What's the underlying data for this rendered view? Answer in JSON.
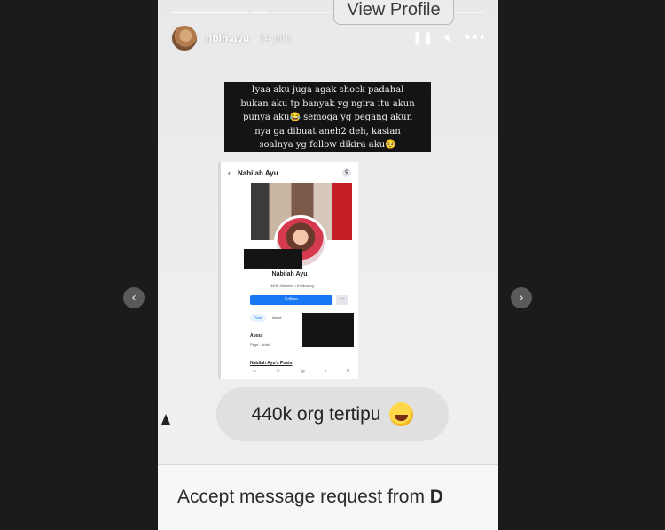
{
  "story": {
    "view_profile": "View Profile",
    "header": {
      "username": "nblh.ayu",
      "time_ago": "14 jam",
      "pause_icon": "pause-icon",
      "mute_icon": "mute-icon",
      "more_icon": "more-icon"
    },
    "caption": "Iyaa aku juga agak shock padahal\nbukan aku tp banyak yg ngira itu akun\npunya aku😂 semoga yg pegang akun\nnya ga dibuat aneh2 deh, kasian\nsoalnya yg follow dikira aku🥺",
    "screenshot": {
      "page_name": "Nabilah Ayu",
      "profile_name": "Nabilah Ayu",
      "stats": "440K followers • 6 following",
      "follow_label": "Follow",
      "tabs": [
        "Posts",
        "About"
      ],
      "about_label": "About",
      "page_type": "Page · Artist",
      "posts_label": "Nabilah Ayu's Posts"
    },
    "reply_bubble": {
      "text": "440k org tertipu",
      "emoji_icon": "rolling-laughing-emoji-icon"
    },
    "accept_message": {
      "text": "Accept message request from ",
      "bold": "D"
    }
  },
  "navigation": {
    "prev_icon": "chevron-left-icon",
    "next_icon": "chevron-right-icon"
  }
}
